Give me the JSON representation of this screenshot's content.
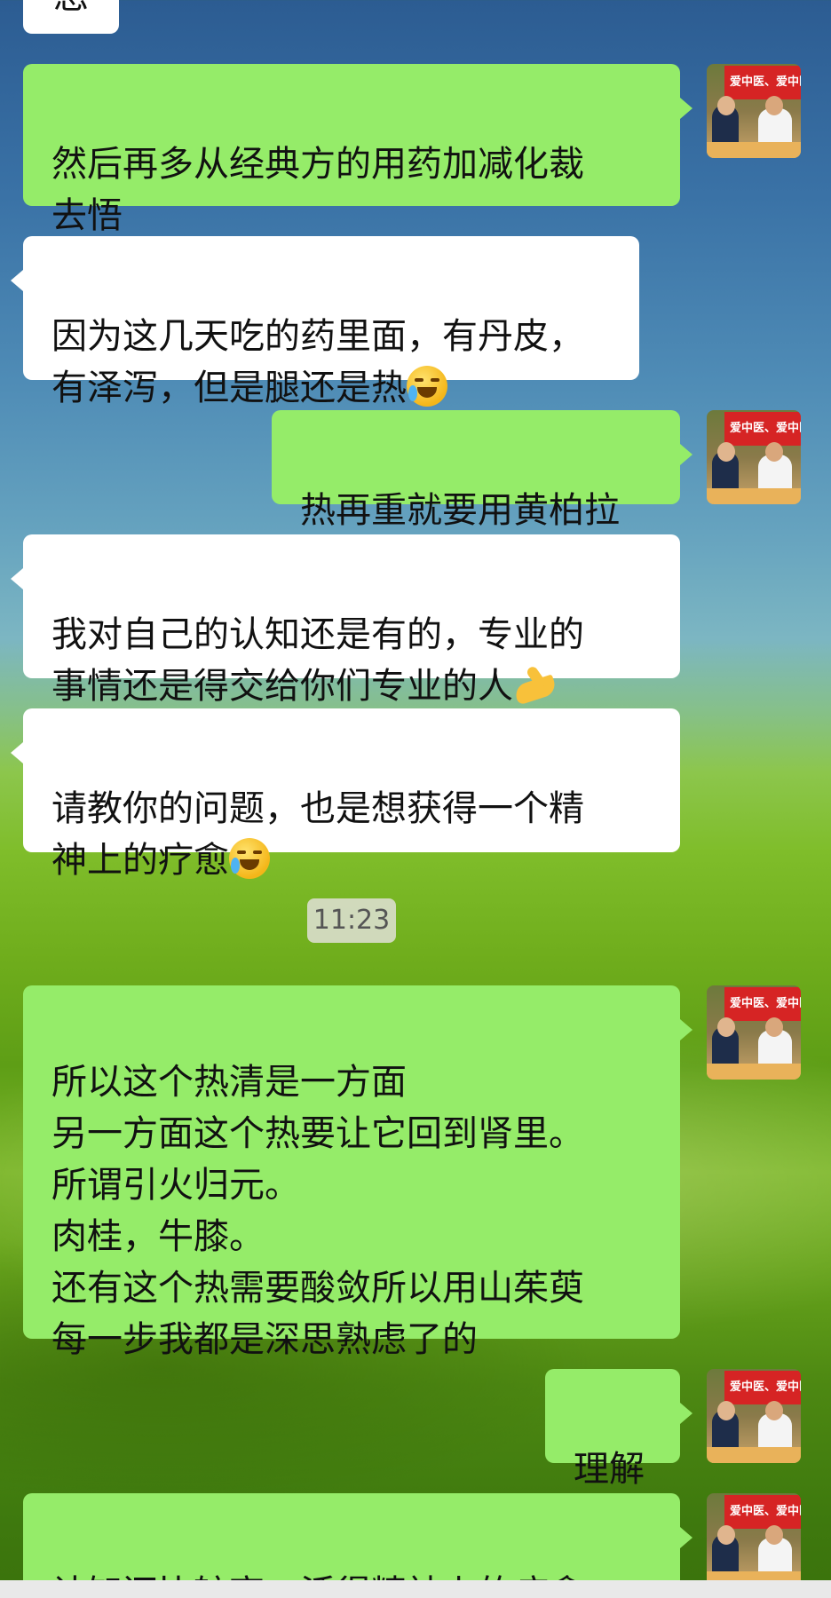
{
  "messages": [
    {
      "side": "in",
      "text": "您"
    },
    {
      "side": "out",
      "text": "然后再多从经典方的用药加减化裁\n去悟"
    },
    {
      "side": "in",
      "text": "因为这几天吃的药里面，有丹皮，\n有泽泻，但是腿还是热",
      "emoji": "face-with-tears-icon"
    },
    {
      "side": "out",
      "text": "热再重就要用黄柏拉"
    },
    {
      "side": "in",
      "text": "我对自己的认知还是有的，专业的\n事情还是得交给你们专业的人",
      "emoji": "pinching-hand-icon"
    },
    {
      "side": "in",
      "text": "请教你的问题，也是想获得一个精\n神上的疗愈",
      "emoji": "face-with-tears-icon"
    },
    {
      "side": "out",
      "text": "所以这个热清是一方面\n另一方面这个热要让它回到肾里。\n所谓引火归元。\n肉桂，牛膝。\n还有这个热需要酸敛所以用山茱萸\n每一步我都是深思熟虑了的"
    },
    {
      "side": "out",
      "text": "理解"
    },
    {
      "side": "out",
      "text": "认知还比较高，活得精神上的疗愈"
    }
  ],
  "timestamp": "11:23",
  "avatar": {
    "banner_text": "爱中医、爱中医、用"
  },
  "colors": {
    "out_bubble": "#95ec69",
    "in_bubble": "#ffffff",
    "banner": "#d62424"
  }
}
